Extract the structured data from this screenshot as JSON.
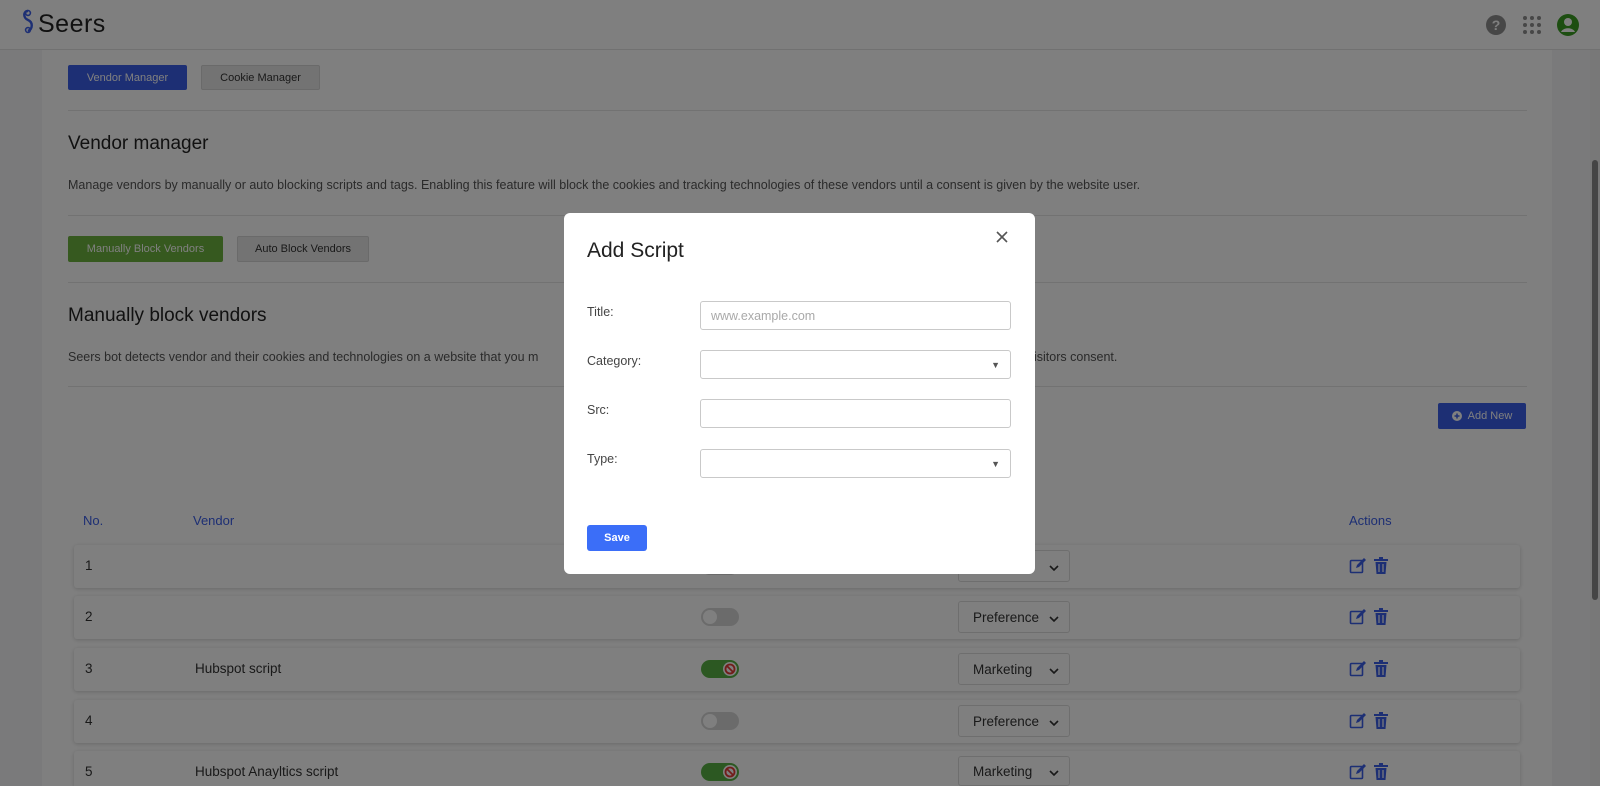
{
  "app": {
    "name": "Seers"
  },
  "tabs": {
    "vendor_manager": "Vendor Manager",
    "cookie_manager": "Cookie Manager"
  },
  "vendor_section": {
    "title": "Vendor manager",
    "description": "Manage vendors by manually or auto blocking scripts and tags. Enabling this feature will block the cookies and tracking technologies of these vendors until a consent is given by the website user."
  },
  "block_tabs": {
    "manual": "Manually Block Vendors",
    "auto": "Auto Block Vendors"
  },
  "manual_section": {
    "title": "Manually block vendors",
    "description_left": "Seers bot detects vendor and their cookies and technologies on a website that you m",
    "description_right": "isitors consent."
  },
  "add_new_label": "Add New",
  "table": {
    "headers": {
      "no": "No.",
      "vendor": "Vendor",
      "actions": "Actions"
    },
    "rows": [
      {
        "no": "1",
        "vendor": "",
        "enabled": false,
        "category": ""
      },
      {
        "no": "2",
        "vendor": "",
        "enabled": false,
        "category": "Preference"
      },
      {
        "no": "3",
        "vendor": "Hubspot script",
        "enabled": true,
        "category": "Marketing"
      },
      {
        "no": "4",
        "vendor": "",
        "enabled": false,
        "category": "Preference"
      },
      {
        "no": "5",
        "vendor": "Hubspot Anayltics script",
        "enabled": true,
        "category": "Marketing"
      }
    ]
  },
  "modal": {
    "title": "Add Script",
    "fields": {
      "title": {
        "label": "Title:",
        "placeholder": "www.example.com",
        "value": ""
      },
      "category": {
        "label": "Category:",
        "value": ""
      },
      "src": {
        "label": "Src:",
        "value": ""
      },
      "type": {
        "label": "Type:",
        "value": ""
      }
    },
    "save_label": "Save"
  },
  "colors": {
    "primary": "#3b5ee8",
    "green": "#6cb33e",
    "overlay": "rgba(0,0,0,0.5)"
  }
}
